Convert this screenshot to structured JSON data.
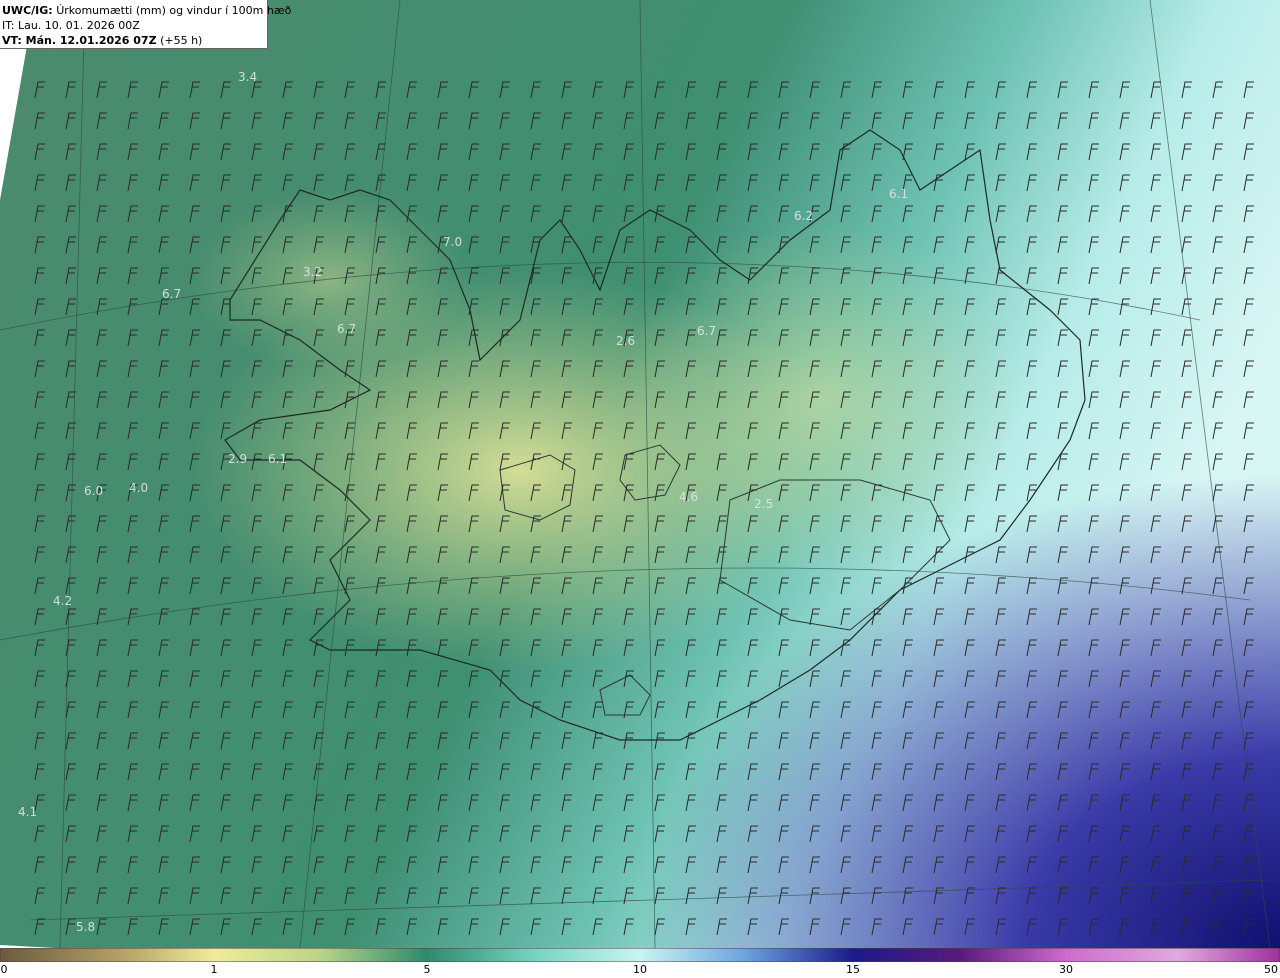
{
  "header": {
    "product": "UWC/IG:",
    "title": "Úrkomumætti (mm) og vindur í 100m hæð",
    "it_label": "IT:",
    "it_value": "Lau. 10. 01. 2026 00Z",
    "vt_label": "VT: Mán. 12.01.2026 07Z",
    "vt_lead": "(+55 h)"
  },
  "field_labels": [
    "3.4",
    "7.0",
    "3.2",
    "6.7",
    "6.7",
    "2.6",
    "6.7",
    "6.2",
    "6.1",
    "2.9",
    "6.1",
    "6.0",
    "4.0",
    "4.6",
    "2.5",
    "4.2",
    "4.1",
    "5.8"
  ],
  "colorbar": {
    "ticks": [
      "0",
      "1",
      "5",
      "10",
      "15",
      "30",
      "50"
    ],
    "colors": [
      "#6b5a3f",
      "#b8a56a",
      "#f0ec9a",
      "#b9d48a",
      "#2f8a6c",
      "#7ad4c4",
      "#c9f4f0",
      "#6ea6e0",
      "#1a1a8a",
      "#5a1a7a",
      "#d06acd",
      "#e0a9e0",
      "#a0309c"
    ]
  },
  "palette": {
    "sea_green": "#3f8d6e",
    "land_yellow": "#c8d48a",
    "sea_cyan": "#b5ece9",
    "deep_blue": "#1b1a86"
  }
}
